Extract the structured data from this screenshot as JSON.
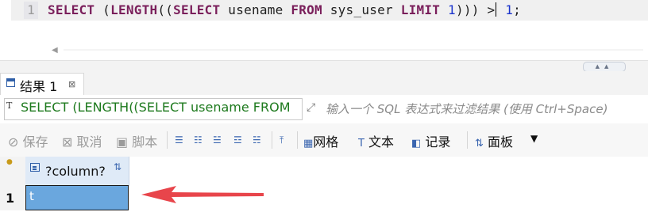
{
  "editor": {
    "line_number": "1",
    "sql": {
      "kw_select": "SELECT",
      "kw_length": "LENGTH",
      "paren1": " (",
      "paren2": "((",
      "kw_select2": "SELECT",
      "col": " usename ",
      "kw_from": "FROM",
      "table": " sys_user ",
      "kw_limit": "LIMIT",
      "sp": " ",
      "num1": "1",
      "close": "))) >",
      "sp2": " ",
      "num2": "1",
      "semi": ";"
    }
  },
  "results_tab": {
    "label": "结果 1",
    "close": "⊠"
  },
  "filter": {
    "icon": "T",
    "value": "SELECT (LENGTH((SELECT usename FROM",
    "placeholder": "输入一个 SQL 表达式来过滤结果 (使用 Ctrl+Space)"
  },
  "toolbar": {
    "save": "保存",
    "cancel": "取消",
    "script": "脚本",
    "grid": "网格",
    "text": "文本",
    "record": "记录",
    "panel": "面板"
  },
  "grid": {
    "column": "?column?",
    "rows": [
      {
        "num": "1",
        "value": "t"
      }
    ]
  },
  "colors": {
    "keyword": "#7a1f5b",
    "number": "#1a33cc",
    "filter_text": "#1e7a1e",
    "selected_cell": "#6aa7de",
    "arrow": "#e8454b"
  }
}
